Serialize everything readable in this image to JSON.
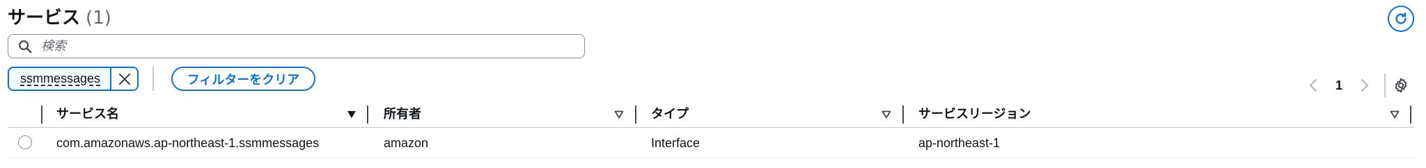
{
  "header": {
    "title": "サービス",
    "count": "(1)"
  },
  "search": {
    "placeholder": "検索",
    "value": ""
  },
  "filter": {
    "token_label": "ssmmessages",
    "clear_label": "フィルターをクリア"
  },
  "pagination": {
    "current_page": "1"
  },
  "table": {
    "columns": [
      {
        "label": "サービス名"
      },
      {
        "label": "所有者"
      },
      {
        "label": "タイプ"
      },
      {
        "label": "サービスリージョン"
      }
    ],
    "rows": [
      {
        "service_name": "com.amazonaws.ap-northeast-1.ssmmessages",
        "owner": "amazon",
        "type": "Interface",
        "region": "ap-northeast-1"
      }
    ]
  },
  "colors": {
    "accent": "#0972d3",
    "text": "#0f141a",
    "muted": "#656871",
    "border": "#8c8c94"
  },
  "icons": {
    "refresh": "refresh-icon",
    "search": "search-icon",
    "dismiss": "close-icon",
    "prev": "chevron-left-icon",
    "next": "chevron-right-icon",
    "settings": "gear-icon",
    "sort_active": "caret-down-filled-icon",
    "sort_inactive": "caret-down-outline-icon"
  }
}
